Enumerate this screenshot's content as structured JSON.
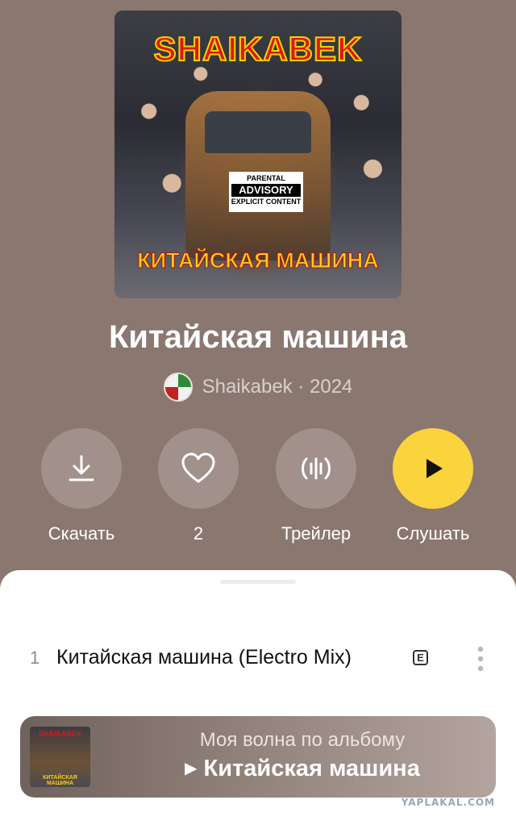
{
  "album": {
    "cover": {
      "top_text": "SHAIKABEK",
      "advisory_line1": "PARENTAL",
      "advisory_line2": "ADVISORY",
      "advisory_line3": "EXPLICIT CONTENT",
      "bottom_text": "КИТАЙСКАЯ МАШИНА"
    },
    "title": "Китайская машина",
    "artist": "Shaikabek",
    "year_sep": "·",
    "year": "2024"
  },
  "actions": [
    {
      "label": "Скачать",
      "icon": "download-icon"
    },
    {
      "label": "2",
      "icon": "heart-icon"
    },
    {
      "label": "Трейлер",
      "icon": "waveform-icon"
    },
    {
      "label": "Слушать",
      "icon": "play-icon"
    }
  ],
  "tracks": [
    {
      "number": "1",
      "title": "Китайская машина (Electro Mix)",
      "explicit": "E"
    }
  ],
  "wave": {
    "subtitle": "Моя волна по альбому",
    "title": "Китайская машина",
    "thumb_top": "SHAIKABEK",
    "thumb_bottom": "КИТАЙСКАЯ МАШИНА"
  },
  "watermark": "YAPLAKAL.COM",
  "colors": {
    "background": "#8a7770",
    "button_circle": "#a2918b",
    "play_accent": "#fbd33c",
    "sheet": "#ffffff"
  }
}
